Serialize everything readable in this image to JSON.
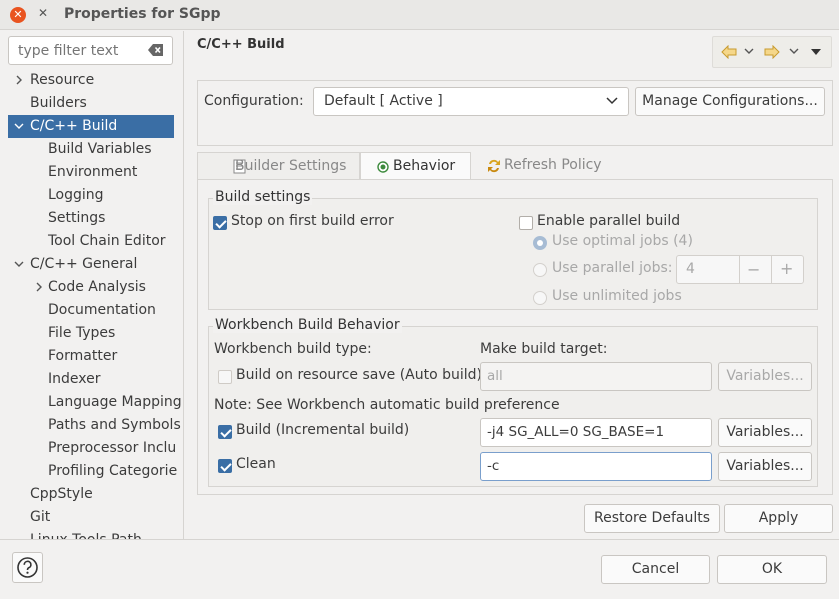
{
  "window": {
    "title": "Properties for SGpp"
  },
  "filter": {
    "placeholder": "type filter text"
  },
  "tree": [
    {
      "label": "Resource",
      "indent": 0,
      "arrow": "right",
      "selected": false
    },
    {
      "label": "Builders",
      "indent": 0,
      "arrow": "",
      "selected": false
    },
    {
      "label": "C/C++ Build",
      "indent": 0,
      "arrow": "down",
      "selected": true
    },
    {
      "label": "Build Variables",
      "indent": 1,
      "arrow": "",
      "selected": false
    },
    {
      "label": "Environment",
      "indent": 1,
      "arrow": "",
      "selected": false
    },
    {
      "label": "Logging",
      "indent": 1,
      "arrow": "",
      "selected": false
    },
    {
      "label": "Settings",
      "indent": 1,
      "arrow": "",
      "selected": false
    },
    {
      "label": "Tool Chain Editor",
      "indent": 1,
      "arrow": "",
      "selected": false
    },
    {
      "label": "C/C++ General",
      "indent": 0,
      "arrow": "down",
      "selected": false
    },
    {
      "label": "Code Analysis",
      "indent": 1,
      "arrow": "right",
      "selected": false
    },
    {
      "label": "Documentation",
      "indent": 1,
      "arrow": "",
      "selected": false
    },
    {
      "label": "File Types",
      "indent": 1,
      "arrow": "",
      "selected": false
    },
    {
      "label": "Formatter",
      "indent": 1,
      "arrow": "",
      "selected": false
    },
    {
      "label": "Indexer",
      "indent": 1,
      "arrow": "",
      "selected": false
    },
    {
      "label": "Language Mapping",
      "indent": 1,
      "arrow": "",
      "selected": false
    },
    {
      "label": "Paths and Symbols",
      "indent": 1,
      "arrow": "",
      "selected": false
    },
    {
      "label": "Preprocessor Inclu",
      "indent": 1,
      "arrow": "",
      "selected": false
    },
    {
      "label": "Profiling Categorie",
      "indent": 1,
      "arrow": "",
      "selected": false
    },
    {
      "label": "CppStyle",
      "indent": 0,
      "arrow": "",
      "selected": false
    },
    {
      "label": "Git",
      "indent": 0,
      "arrow": "",
      "selected": false
    },
    {
      "label": "Linux Tools Path",
      "indent": 0,
      "arrow": "",
      "selected": false
    }
  ],
  "page": {
    "title": "C/C++ Build"
  },
  "config": {
    "label": "Configuration:",
    "value": "Default  [ Active ]",
    "manage": "Manage Configurations..."
  },
  "tabs": [
    {
      "label": "Builder Settings",
      "icon": "builder-settings-icon",
      "active": false
    },
    {
      "label": "Behavior",
      "icon": "behavior-icon",
      "active": true
    },
    {
      "label": "Refresh Policy",
      "icon": "refresh-policy-icon",
      "active": false
    }
  ],
  "build_settings": {
    "title": "Build settings",
    "stop_on_error": {
      "label": "Stop on first build error",
      "checked": true
    },
    "parallel": {
      "label": "Enable parallel build",
      "checked": false
    },
    "optimal": "Use optimal jobs (4)",
    "parallel_jobs": "Use parallel jobs:",
    "jobs_value": "4",
    "minus": "−",
    "plus": "+",
    "unlimited": "Use unlimited jobs"
  },
  "workbench": {
    "title": "Workbench Build Behavior",
    "type_label": "Workbench build type:",
    "target_label": "Make build target:",
    "auto": {
      "label": "Build on resource save (Auto build)",
      "checked": false,
      "value": "all"
    },
    "note": "Note: See Workbench automatic build preference",
    "incremental": {
      "label": "Build (Incremental build)",
      "checked": true,
      "value": "-j4 SG_ALL=0 SG_BASE=1"
    },
    "clean": {
      "label": "Clean",
      "checked": true,
      "value": "-c"
    },
    "variables": "Variables..."
  },
  "actions": {
    "restore": "Restore Defaults",
    "apply": "Apply",
    "cancel": "Cancel",
    "ok": "OK"
  }
}
